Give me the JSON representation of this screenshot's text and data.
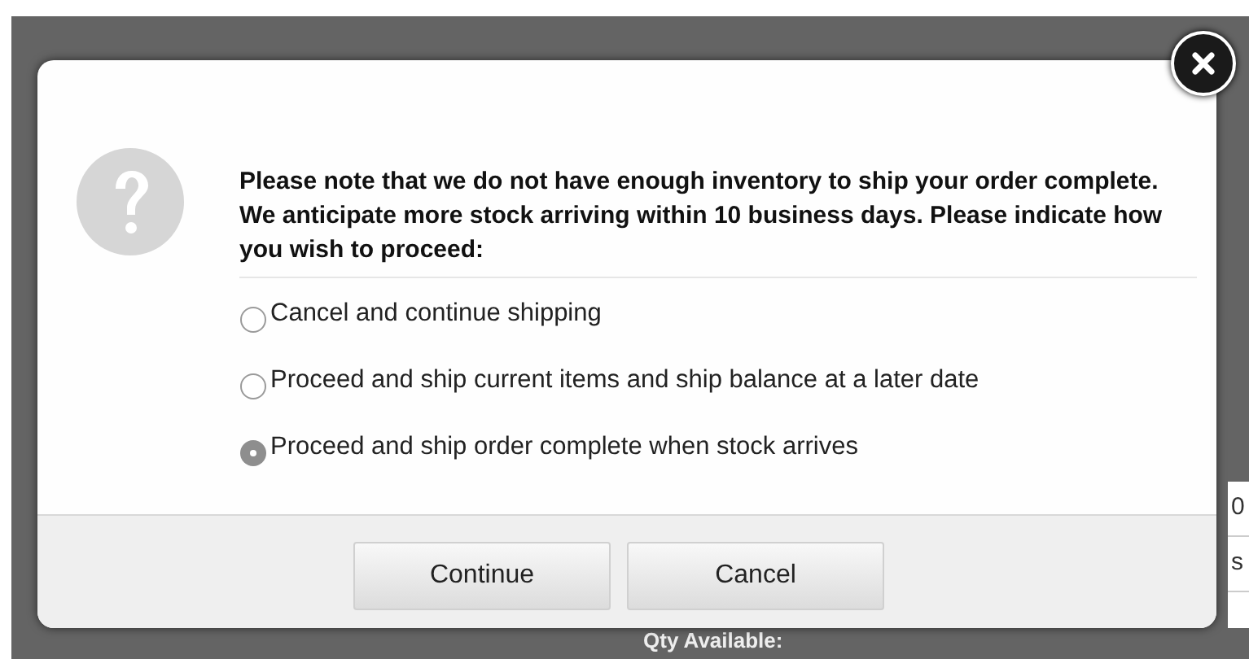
{
  "dialog": {
    "message": "Please note that we do not have enough inventory to ship your order complete. We anticipate more stock arriving within 10 business days. Please indicate how you wish to proceed:",
    "options": [
      {
        "label": "Cancel and continue shipping",
        "selected": false
      },
      {
        "label": "Proceed and ship current items and ship balance at a later date",
        "selected": false
      },
      {
        "label": "Proceed and ship order complete when stock arrives",
        "selected": true
      }
    ],
    "buttons": [
      "Continue",
      "Cancel"
    ]
  },
  "background": {
    "cells": [
      "0",
      "s"
    ],
    "label": "Qty Available:"
  }
}
